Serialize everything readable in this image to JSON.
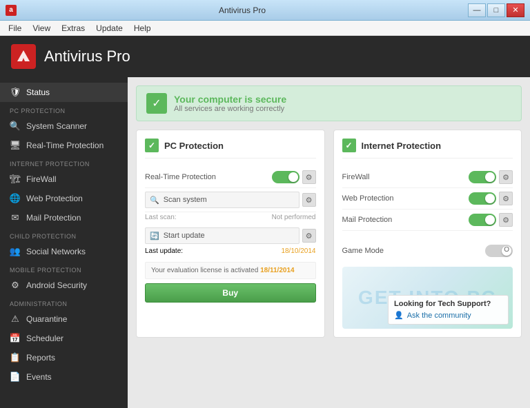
{
  "window": {
    "title": "Antivirus Pro",
    "controls": {
      "minimize": "—",
      "maximize": "□",
      "close": "✕"
    }
  },
  "menubar": {
    "items": [
      "File",
      "View",
      "Extras",
      "Update",
      "Help"
    ]
  },
  "app": {
    "title": "Antivirus Pro"
  },
  "sidebar": {
    "sections": [
      {
        "label": "",
        "items": [
          {
            "id": "status",
            "label": "Status",
            "icon": "🛡"
          }
        ]
      },
      {
        "label": "PC PROTECTION",
        "items": [
          {
            "id": "system-scanner",
            "label": "System Scanner",
            "icon": "🔍"
          },
          {
            "id": "realtime-protection",
            "label": "Real-Time Protection",
            "icon": "🖥"
          }
        ]
      },
      {
        "label": "INTERNET PROTECTION",
        "items": [
          {
            "id": "firewall",
            "label": "FireWall",
            "icon": "🏗"
          },
          {
            "id": "web-protection",
            "label": "Web Protection",
            "icon": "🌐"
          },
          {
            "id": "mail-protection",
            "label": "Mail Protection",
            "icon": "✉"
          }
        ]
      },
      {
        "label": "CHILD PROTECTION",
        "items": [
          {
            "id": "social-networks",
            "label": "Social Networks",
            "icon": "👥"
          }
        ]
      },
      {
        "label": "MOBILE PROTECTION",
        "items": [
          {
            "id": "android-security",
            "label": "Android Security",
            "icon": "⚙"
          }
        ]
      },
      {
        "label": "ADMINISTRATION",
        "items": [
          {
            "id": "quarantine",
            "label": "Quarantine",
            "icon": "⚠"
          },
          {
            "id": "scheduler",
            "label": "Scheduler",
            "icon": "📅"
          },
          {
            "id": "reports",
            "label": "Reports",
            "icon": "📋"
          },
          {
            "id": "events",
            "label": "Events",
            "icon": "📄"
          }
        ]
      }
    ]
  },
  "status_banner": {
    "title": "Your computer is secure",
    "subtitle": "All services are working correctly"
  },
  "pc_protection": {
    "title": "PC Protection",
    "rows": [
      {
        "label": "Real-Time Protection",
        "enabled": true
      },
      {
        "label": "Scan system",
        "type": "scan",
        "sub_label": "Last scan:",
        "sub_value": "Not performed"
      },
      {
        "label": "Start update",
        "type": "update",
        "sub_label": "Last update:",
        "sub_value": "18/10/2014"
      }
    ],
    "license_text": "Your evaluation license is activated",
    "license_date": "18/11/2014",
    "buy_label": "Buy"
  },
  "internet_protection": {
    "title": "Internet Protection",
    "rows": [
      {
        "label": "FireWall",
        "enabled": true
      },
      {
        "label": "Web Protection",
        "enabled": true
      },
      {
        "label": "Mail Protection",
        "enabled": true
      }
    ],
    "game_mode": {
      "label": "Game Mode",
      "enabled": false
    }
  },
  "tech_support": {
    "title": "Looking for Tech Support?",
    "link": "Ask the community"
  },
  "watermark": {
    "line1": "GET INTO PC"
  }
}
